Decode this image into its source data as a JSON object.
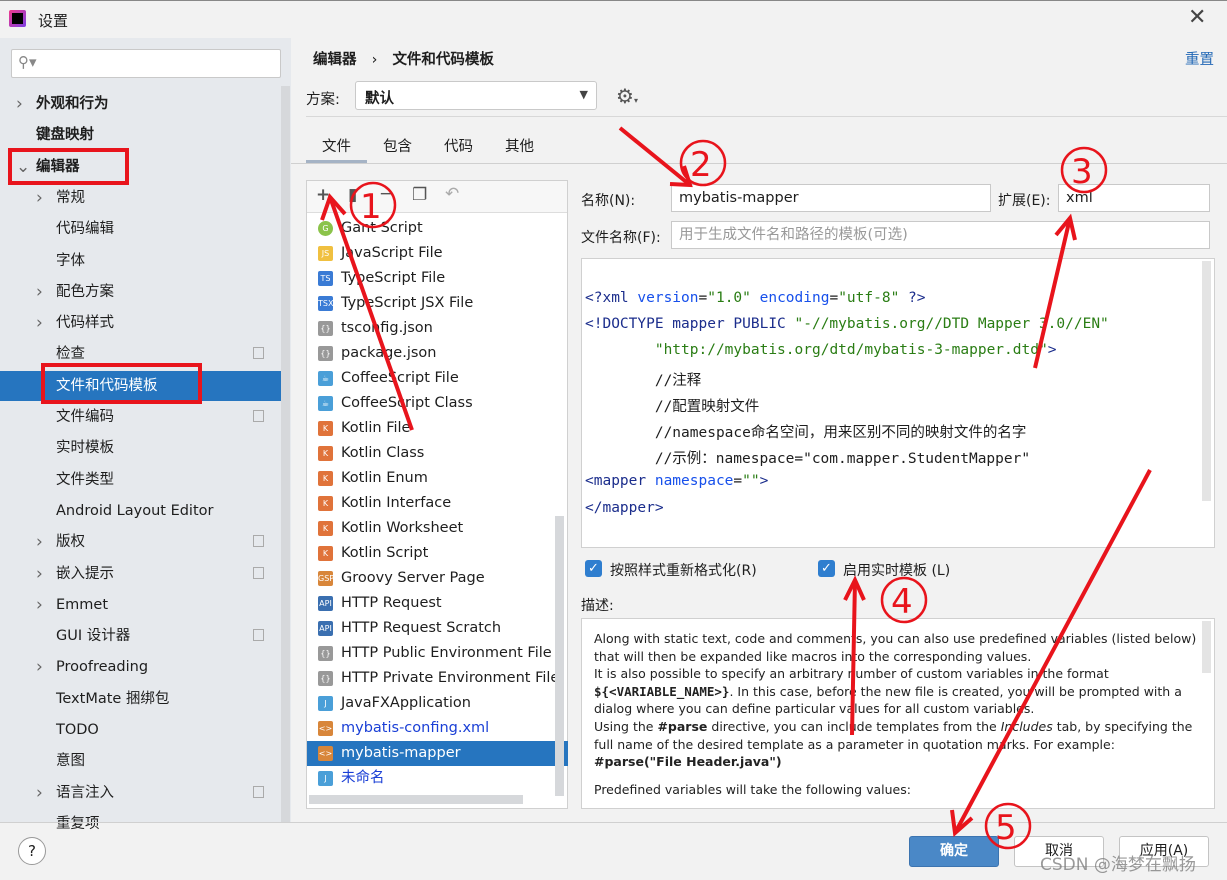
{
  "window": {
    "title": "设置",
    "close_icon": "close-icon"
  },
  "sidebar": {
    "search_placeholder": "",
    "items": [
      {
        "label": "外观和行为",
        "level": 0,
        "bold": true,
        "expandable": true
      },
      {
        "label": "键盘映射",
        "level": 0,
        "bold": true
      },
      {
        "label": "编辑器",
        "level": 0,
        "bold": true,
        "expanded": true
      },
      {
        "label": "常规",
        "level": 1,
        "expandable": true
      },
      {
        "label": "代码编辑",
        "level": 1
      },
      {
        "label": "字体",
        "level": 1
      },
      {
        "label": "配色方案",
        "level": 1,
        "expandable": true
      },
      {
        "label": "代码样式",
        "level": 1,
        "expandable": true
      },
      {
        "label": "检查",
        "level": 1,
        "copy": true
      },
      {
        "label": "文件和代码模板",
        "level": 1,
        "selected": true
      },
      {
        "label": "文件编码",
        "level": 1,
        "copy": true
      },
      {
        "label": "实时模板",
        "level": 1
      },
      {
        "label": "文件类型",
        "level": 1
      },
      {
        "label": "Android Layout Editor",
        "level": 1
      },
      {
        "label": "版权",
        "level": 1,
        "expandable": true,
        "copy": true
      },
      {
        "label": "嵌入提示",
        "level": 1,
        "expandable": true,
        "copy": true
      },
      {
        "label": "Emmet",
        "level": 1,
        "expandable": true
      },
      {
        "label": "GUI 设计器",
        "level": 1,
        "copy": true
      },
      {
        "label": "Proofreading",
        "level": 1,
        "expandable": true
      },
      {
        "label": "TextMate 捆绑包",
        "level": 1
      },
      {
        "label": "TODO",
        "level": 1
      },
      {
        "label": "意图",
        "level": 1
      },
      {
        "label": "语言注入",
        "level": 1,
        "expandable": true,
        "copy": true
      },
      {
        "label": "重复项",
        "level": 1
      }
    ]
  },
  "header": {
    "breadcrumb_parent": "编辑器",
    "breadcrumb_current": "文件和代码模板",
    "reset": "重置"
  },
  "scheme": {
    "label": "方案:",
    "value": "默认"
  },
  "tabs": [
    {
      "label": "文件",
      "active": true
    },
    {
      "label": "包含"
    },
    {
      "label": "代码"
    },
    {
      "label": "其他"
    }
  ],
  "templates": [
    {
      "label": "Gant Script",
      "icon": "G",
      "color": "#8bc34a"
    },
    {
      "label": "JavaScript File",
      "icon": "JS",
      "color": "#f0c040"
    },
    {
      "label": "TypeScript File",
      "icon": "TS",
      "color": "#3a7bd5"
    },
    {
      "label": "TypeScript JSX File",
      "icon": "TSX",
      "color": "#3a7bd5"
    },
    {
      "label": "tsconfig.json",
      "icon": "{}",
      "color": "#999"
    },
    {
      "label": "package.json",
      "icon": "{}",
      "color": "#999"
    },
    {
      "label": "CoffeeScript File",
      "icon": "☕",
      "color": "#4a9fd8"
    },
    {
      "label": "CoffeeScript Class",
      "icon": "☕",
      "color": "#4a9fd8"
    },
    {
      "label": "Kotlin File",
      "icon": "K",
      "color": "#e0733a"
    },
    {
      "label": "Kotlin Class",
      "icon": "K",
      "color": "#e0733a"
    },
    {
      "label": "Kotlin Enum",
      "icon": "K",
      "color": "#e0733a"
    },
    {
      "label": "Kotlin Interface",
      "icon": "K",
      "color": "#e0733a"
    },
    {
      "label": "Kotlin Worksheet",
      "icon": "K",
      "color": "#e0733a"
    },
    {
      "label": "Kotlin Script",
      "icon": "K",
      "color": "#e0733a"
    },
    {
      "label": "Groovy Server Page",
      "icon": "GSP",
      "color": "#d8863a"
    },
    {
      "label": "HTTP Request",
      "icon": "API",
      "color": "#3a6fb0"
    },
    {
      "label": "HTTP Request Scratch",
      "icon": "API",
      "color": "#3a6fb0"
    },
    {
      "label": "HTTP Public Environment File",
      "icon": "{}",
      "color": "#999"
    },
    {
      "label": "HTTP Private Environment File",
      "icon": "{}",
      "color": "#999"
    },
    {
      "label": "JavaFXApplication",
      "icon": "J",
      "color": "#4a9fd8"
    },
    {
      "label": "mybatis-confing.xml",
      "icon": "<>",
      "color": "#d8863a",
      "blue": true
    },
    {
      "label": "mybatis-mapper",
      "icon": "<>",
      "color": "#d8863a",
      "selected": true
    },
    {
      "label": "未命名",
      "icon": "J",
      "color": "#4a9fd8",
      "blue": true
    }
  ],
  "form": {
    "name_label": "名称(N):",
    "name_value": "mybatis-mapper",
    "ext_label": "扩展(E):",
    "ext_value": "xml",
    "filename_label": "文件名称(F):",
    "filename_placeholder": "用于生成文件名和路径的模板(可选)"
  },
  "code": [
    [
      [
        "tg",
        "<?xml "
      ],
      [
        "at",
        "version"
      ],
      [
        "",
        "="
      ],
      [
        "st",
        "\"1.0\""
      ],
      [
        "at",
        " encoding"
      ],
      [
        "",
        "="
      ],
      [
        "st",
        "\"utf-8\""
      ],
      [
        "tg",
        " ?>"
      ]
    ],
    [
      [
        "tg",
        "<!DOCTYPE mapper PUBLIC "
      ],
      [
        "st",
        "\"-//mybatis.org//DTD Mapper 3.0//EN\""
      ]
    ],
    [
      [
        "",
        "        "
      ],
      [
        "st",
        "\"http://mybatis.org/dtd/mybatis-3-mapper.dtd\""
      ],
      [
        "tg",
        ">"
      ]
    ],
    [
      [
        "",
        "        //注释"
      ]
    ],
    [
      [
        "",
        "        //配置映射文件"
      ]
    ],
    [
      [
        "",
        "        //namespace命名空间，用来区别不同的映射文件的名字"
      ]
    ],
    [
      [
        "",
        "        //示例：namespace=\"com.mapper.StudentMapper\""
      ]
    ],
    [
      [
        "tg",
        "<mapper "
      ],
      [
        "at",
        "namespace"
      ],
      [
        "",
        "="
      ],
      [
        "st",
        "\"\""
      ],
      [
        "tg",
        ">"
      ]
    ],
    [
      [
        "tg",
        "</mapper>"
      ]
    ]
  ],
  "options": {
    "reformat": {
      "label": "按照样式重新格式化(R)",
      "checked": true
    },
    "live": {
      "label": "启用实时模板 (L)",
      "checked": true
    }
  },
  "description": {
    "label": "描述:",
    "p1": "Along with static text, code and comments, you can also use predefined variables (listed below) that will then be expanded like macros into the corresponding values.",
    "p2a": "It is also possible to specify an arbitrary number of custom variables in the format ",
    "p2b": "${<VARIABLE_NAME>}",
    "p2c": ". In this case, before the new file is created, you will be prompted with a dialog where you can define particular values for all custom variables.",
    "p3a": "Using the ",
    "p3b": "#parse",
    "p3c": " directive, you can include templates from the ",
    "p3d": "Includes",
    "p3e": " tab, by specifying the full name of the desired template as a parameter in quotation marks. For example:",
    "p4": "#parse(\"File Header.java\")",
    "p5": "Predefined variables will take the following values:"
  },
  "buttons": {
    "ok": "确定",
    "cancel": "取消",
    "apply": "应用(A)",
    "help": "?"
  },
  "annotations": [
    "①",
    "②",
    "③",
    "④",
    "⑤"
  ],
  "watermark": "CSDN @海梦在飘扬",
  "colors": {
    "selection": "#2675bf",
    "annotation": "#e8141c",
    "primary_button": "#4a88c7"
  }
}
